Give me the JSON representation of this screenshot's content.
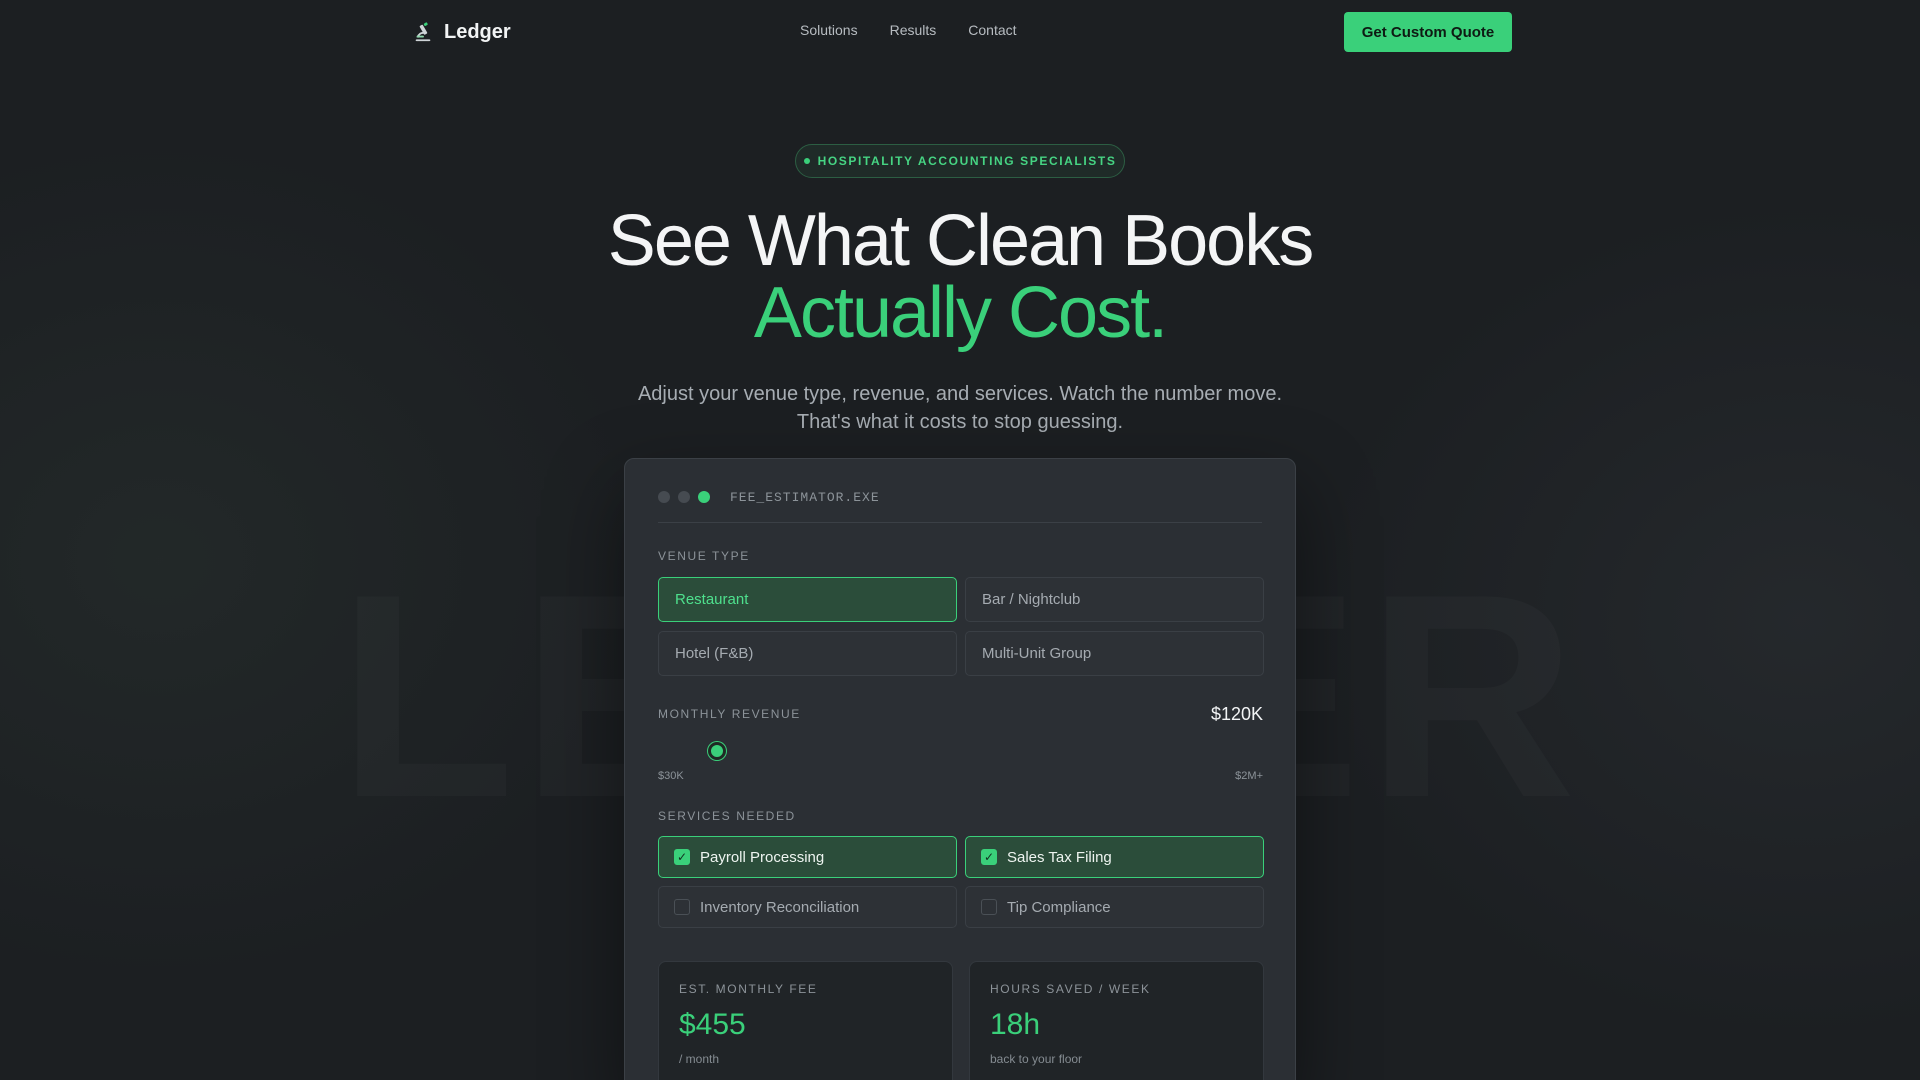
{
  "nav": {
    "brand": "Ledger",
    "brand_icon": "microscope-icon",
    "links": [
      "Solutions",
      "Results",
      "Contact"
    ],
    "cta_label": "Get Custom Quote"
  },
  "hero": {
    "badge": "HOSPITALITY ACCOUNTING SPECIALISTS",
    "headline_line1": "See What Clean Books",
    "headline_line2": "Actually Cost.",
    "subhead_line1": "Adjust your venue type, revenue, and services. Watch the number move.",
    "subhead_line2": "That's what it costs to stop guessing."
  },
  "estimator": {
    "window_title": "FEE_ESTIMATOR.EXE",
    "venue_label": "VENUE TYPE",
    "venues": [
      {
        "label": "Restaurant",
        "selected": true
      },
      {
        "label": "Bar / Nightclub",
        "selected": false
      },
      {
        "label": "Hotel (F&B)",
        "selected": false
      },
      {
        "label": "Multi-Unit Group",
        "selected": false
      }
    ],
    "revenue_label": "MONTHLY REVENUE",
    "revenue_value": "$120K",
    "revenue_min": "$30K",
    "revenue_max": "$2M+",
    "revenue_slider_fraction": 0.05,
    "services_label": "SERVICES NEEDED",
    "services": [
      {
        "label": "Payroll Processing",
        "checked": true
      },
      {
        "label": "Sales Tax Filing",
        "checked": true
      },
      {
        "label": "Inventory Reconciliation",
        "checked": false
      },
      {
        "label": "Tip Compliance",
        "checked": false
      }
    ],
    "fee_label": "EST. MONTHLY FEE",
    "fee_value": "$455",
    "fee_sub": "/ month",
    "hours_label": "HOURS SAVED / WEEK",
    "hours_value": "18h",
    "hours_sub": "back to your floor"
  },
  "colors": {
    "accent": "#3ad07a",
    "background": "#1c1f22",
    "card": "#2b2f34"
  }
}
